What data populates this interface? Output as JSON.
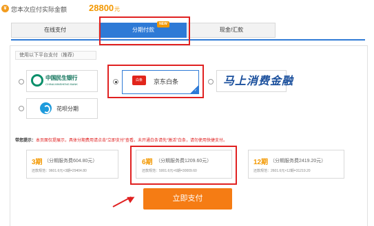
{
  "amount": {
    "label": "您本次应付实际金额",
    "value": "28800",
    "unit": "元",
    "icon": "yen-icon"
  },
  "tabs": [
    {
      "label": "在线支付",
      "selected": false
    },
    {
      "label": "分期付款",
      "selected": true,
      "badge": "NEW"
    },
    {
      "label": "现金/汇款",
      "selected": false
    }
  ],
  "platforms": {
    "title": "使用以下平台支付（推荐）",
    "items": [
      {
        "name": "中国民生银行",
        "sub": "CHINA MINSHENG BANK",
        "selected": false
      },
      {
        "name": "京东白条",
        "logo_text": "白条",
        "selected": true
      },
      {
        "name": "马上消费金融",
        "selected": false
      },
      {
        "name": "花呗分期",
        "selected": false
      }
    ]
  },
  "tip": {
    "label": "带您提示：",
    "text": "本页面仅提展示，具体分期费用请点击“立即支付”查看。未开通白条请先“激活”白条，请勿使用快捷支付。"
  },
  "plans": [
    {
      "period": "3期",
      "fee": "（分期服务费604.80元）",
      "detail": "还款规范：9601.6元×3期=29404.80",
      "selected": false
    },
    {
      "period": "6期",
      "fee": "（分期服务费1209.60元）",
      "detail": "还款规范：5001.6元×6期=30009.60",
      "selected": true
    },
    {
      "period": "12期",
      "fee": "（分期服务费2419.20元）",
      "detail": "还款规范：2601.6元×12期=31219.20",
      "selected": false
    }
  ],
  "pay_button": {
    "label": "立即支付"
  },
  "colors": {
    "accent": "#2e7ad6",
    "orange": "#f39800",
    "button": "#f57c14",
    "annotation": "#e02020"
  }
}
